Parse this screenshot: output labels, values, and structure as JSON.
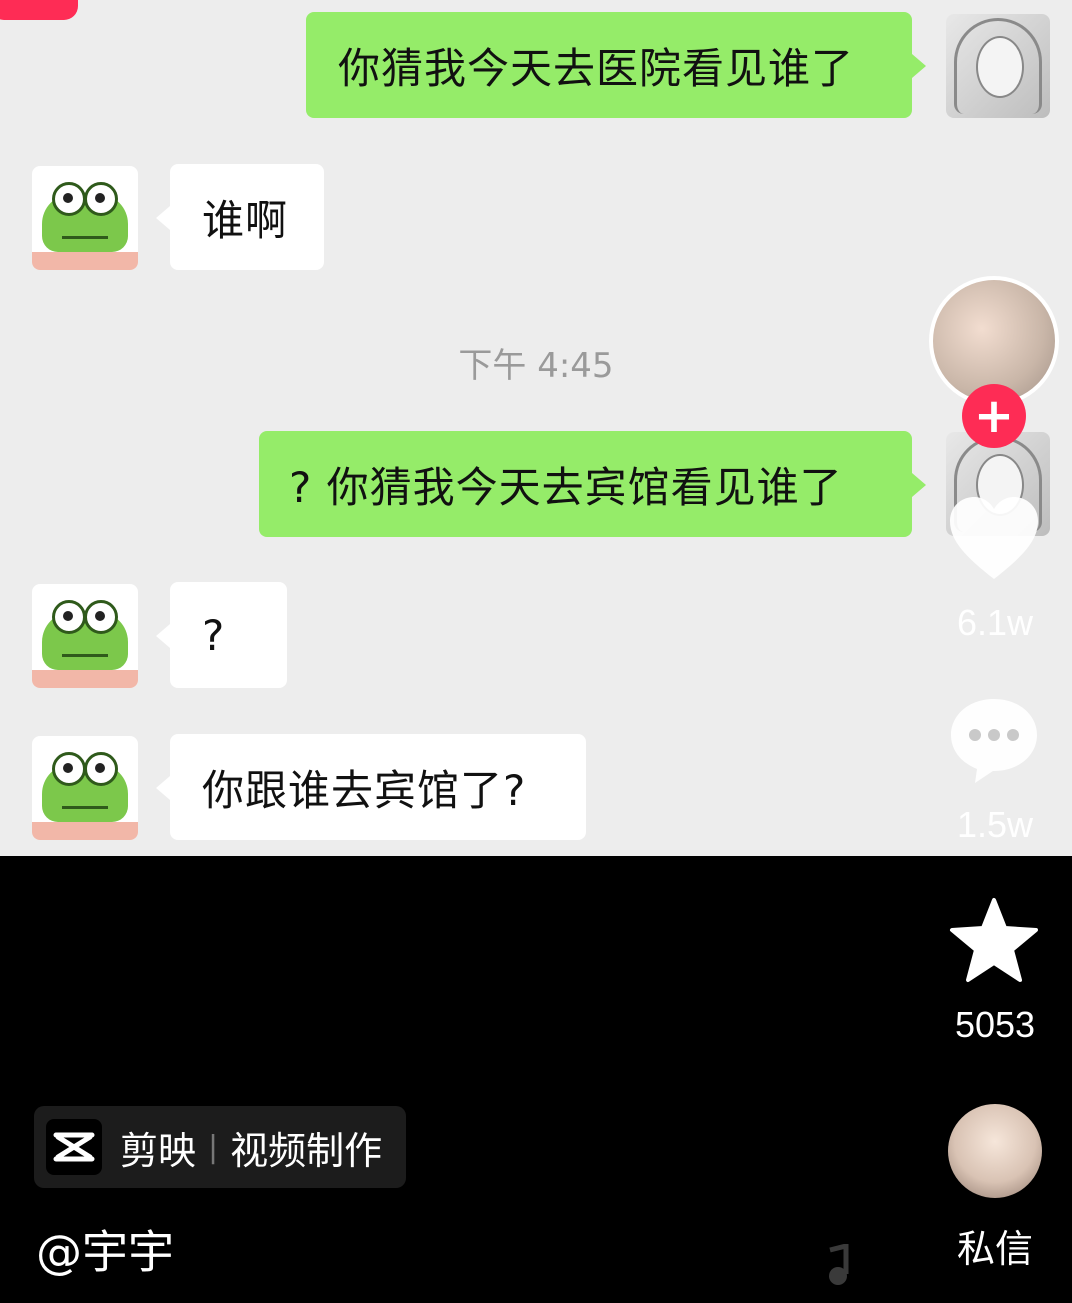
{
  "chat": {
    "messages": [
      {
        "side": "me",
        "text": "你猜我今天去医院看见谁了"
      },
      {
        "side": "them",
        "text": "谁啊"
      },
      {
        "side": "me",
        "text": "? 你猜我今天去宾馆看见谁了"
      },
      {
        "side": "them",
        "text": "?"
      },
      {
        "side": "them",
        "text": "你跟谁去宾馆了?"
      }
    ],
    "timestamp": "下午 4:45"
  },
  "rail": {
    "follow_symbol": "+",
    "like_count": "6.1w",
    "comment_count": "1.5w",
    "favorite_count": "5053",
    "dm_label": "私信"
  },
  "capcut": {
    "app_name": "剪映",
    "separator": "|",
    "tagline": "视频制作"
  },
  "author": {
    "handle": "@宇宇"
  },
  "colors": {
    "my_bubble": "#95ec69",
    "their_bubble": "#ffffff",
    "accent": "#fe2c55",
    "chat_bg": "#ededed"
  }
}
